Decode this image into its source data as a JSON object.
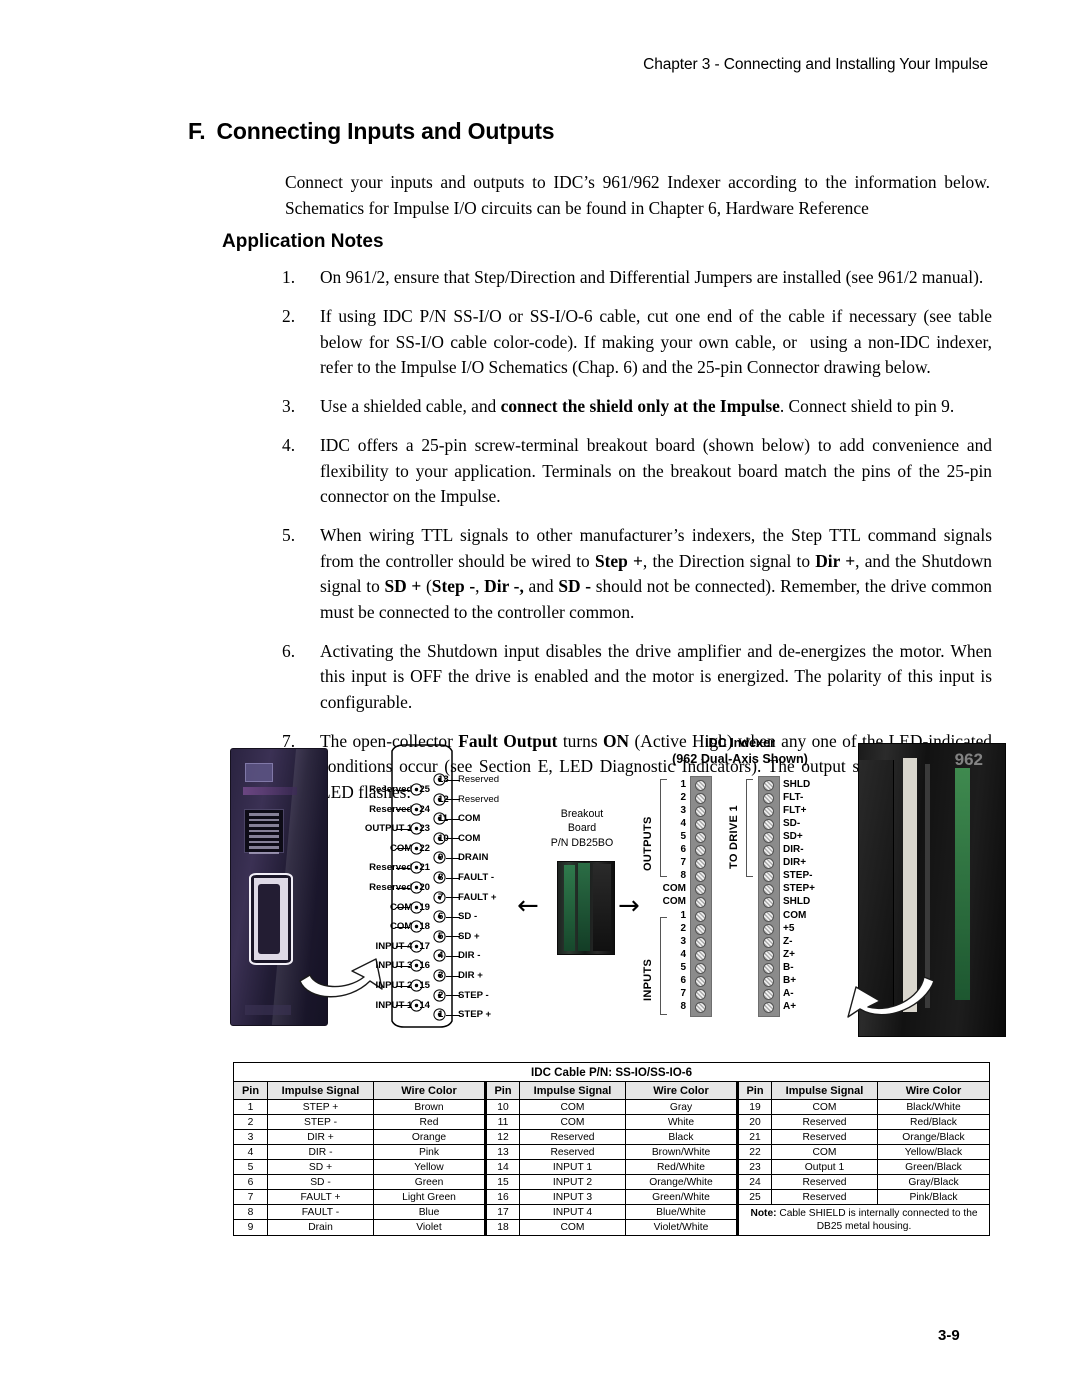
{
  "header": {
    "running_head": "Chapter 3 - Connecting and Installing Your Impulse"
  },
  "section": {
    "letter": "F.",
    "title": "Connecting Inputs and Outputs",
    "intro": "Connect your inputs and outputs to IDC’s 961/962 Indexer according to the information below. Schematics for Impulse I/O circuits can be found in Chapter 6, Hardware Reference",
    "subsection_title": "Application Notes"
  },
  "notes": [
    {
      "num": "1.",
      "html": "On 961/2, ensure that Step/Direction and Differential Jumpers are installed (see 961/2 manual)."
    },
    {
      "num": "2.",
      "html": "If using IDC P/N SS-I/O or SS-I/O-6 cable, cut one end of the cable if necessary (see table below for SS-I/O cable color-code). If making your own cable, or&nbsp; using a non-IDC indexer, refer to the Impulse I/O Schematics (Chap. 6) and the 25-pin Connector drawing below."
    },
    {
      "num": "3.",
      "html": "Use a shielded cable, and <b>connect the shield only at the Impulse</b>. Connect shield to pin 9."
    },
    {
      "num": "4.",
      "html": "IDC offers a 25-pin screw-terminal breakout board (shown below) to add convenience and flexibility to your application. Terminals on the breakout board match the pins of the 25-pin connector on the Impulse."
    },
    {
      "num": "5.",
      "html": "When wiring TTL signals to other manufacturer’s indexers, the Step TTL command signals from the controller should be wired to <b>Step +</b>, the Direction signal to <b>Dir +</b>, and the Shutdown signal to <b>SD +</b> (<b>Step -</b>, <b>Dir -,</b> and <b>SD -</b> should not be connected). Remember, the drive common must be connected to the controller common."
    },
    {
      "num": "6.",
      "html": "Activating the Shutdown input disables the drive amplifier and de-energizes the motor. When this input is OFF the drive is enabled and the motor is energized. The polarity of this input is configurable."
    },
    {
      "num": "7.",
      "html": "The open-collector <b>Fault Output</b> turns <b>ON</b> (Active High) when any one of the LED-indicated conditions occur (see Section E, LED Diagnostic Indicators). The output stays ON while the LED flashes."
    }
  ],
  "figure": {
    "db25_left_pins": [
      {
        "num": "25",
        "signal": "Reserved"
      },
      {
        "num": "24",
        "signal": "Reserved"
      },
      {
        "num": "23",
        "signal": "OUTPUT 1"
      },
      {
        "num": "22",
        "signal": "COM"
      },
      {
        "num": "21",
        "signal": "Reserved"
      },
      {
        "num": "20",
        "signal": "Reserved"
      },
      {
        "num": "19",
        "signal": "COM"
      },
      {
        "num": "18",
        "signal": "COM"
      },
      {
        "num": "17",
        "signal": "INPUT 4"
      },
      {
        "num": "16",
        "signal": "INPUT 3"
      },
      {
        "num": "15",
        "signal": "INPUT 2"
      },
      {
        "num": "14",
        "signal": "INPUT 1"
      }
    ],
    "db25_right_pins": [
      {
        "num": "13",
        "signal": "Reserved"
      },
      {
        "num": "12",
        "signal": "Reserved"
      },
      {
        "num": "11",
        "signal": "COM"
      },
      {
        "num": "10",
        "signal": "COM"
      },
      {
        "num": "9",
        "signal": "DRAIN"
      },
      {
        "num": "8",
        "signal": "FAULT -"
      },
      {
        "num": "7",
        "signal": "FAULT +"
      },
      {
        "num": "6",
        "signal": "SD -"
      },
      {
        "num": "5",
        "signal": "SD +"
      },
      {
        "num": "4",
        "signal": "DIR -"
      },
      {
        "num": "3",
        "signal": "DIR +"
      },
      {
        "num": "2",
        "signal": "STEP -"
      },
      {
        "num": "1",
        "signal": "STEP +"
      }
    ],
    "breakout": {
      "line1": "Breakout",
      "line2": "Board",
      "line3": "P/N DB25BO"
    },
    "indexer": {
      "title_line1": "IDC Indexer",
      "title_line2": "(962 Dual-Axis Shown)",
      "group_outputs": "OUTPUTS",
      "group_inputs": "INPUTS",
      "group_drive": "TO DRIVE 1",
      "left_terminals": [
        "1",
        "2",
        "3",
        "4",
        "5",
        "6",
        "7",
        "8",
        "COM",
        "COM",
        "1",
        "2",
        "3",
        "4",
        "5",
        "6",
        "7",
        "8"
      ],
      "right_terminals": [
        "SHLD",
        "FLT-",
        "FLT+",
        "SD-",
        "SD+",
        "DIR-",
        "DIR+",
        "STEP-",
        "STEP+",
        "SHLD",
        "COM",
        "+5",
        "Z-",
        "Z+",
        "B-",
        "B+",
        "A-",
        "A+"
      ],
      "photo_model": "962"
    }
  },
  "cable_table": {
    "title": "IDC Cable P/N: SS-IO/SS-IO-6",
    "headers": [
      "Pin",
      "Impulse Signal",
      "Wire Color"
    ],
    "col1": [
      [
        "1",
        "STEP +",
        "Brown"
      ],
      [
        "2",
        "STEP -",
        "Red"
      ],
      [
        "3",
        "DIR +",
        "Orange"
      ],
      [
        "4",
        "DIR -",
        "Pink"
      ],
      [
        "5",
        "SD +",
        "Yellow"
      ],
      [
        "6",
        "SD -",
        "Green"
      ],
      [
        "7",
        "FAULT +",
        "Light Green"
      ],
      [
        "8",
        "FAULT -",
        "Blue"
      ],
      [
        "9",
        "Drain",
        "Violet"
      ]
    ],
    "col2": [
      [
        "10",
        "COM",
        "Gray"
      ],
      [
        "11",
        "COM",
        "White"
      ],
      [
        "12",
        "Reserved",
        "Black"
      ],
      [
        "13",
        "Reserved",
        "Brown/White"
      ],
      [
        "14",
        "INPUT 1",
        "Red/White"
      ],
      [
        "15",
        "INPUT 2",
        "Orange/White"
      ],
      [
        "16",
        "INPUT 3",
        "Green/White"
      ],
      [
        "17",
        "INPUT 4",
        "Blue/White"
      ],
      [
        "18",
        "COM",
        "Violet/White"
      ]
    ],
    "col3": [
      [
        "19",
        "COM",
        "Black/White"
      ],
      [
        "20",
        "Reserved",
        "Red/Black"
      ],
      [
        "21",
        "Reserved",
        "Orange/Black"
      ],
      [
        "22",
        "COM",
        "Yellow/Black"
      ],
      [
        "23",
        "Output 1",
        "Green/Black"
      ],
      [
        "24",
        "Reserved",
        "Gray/Black"
      ],
      [
        "25",
        "Reserved",
        "Pink/Black"
      ]
    ],
    "note_label": "Note:",
    "note_text": " Cable SHIELD is internally connected to the DB25 metal housing."
  },
  "footer": {
    "page_number": "3-9"
  }
}
